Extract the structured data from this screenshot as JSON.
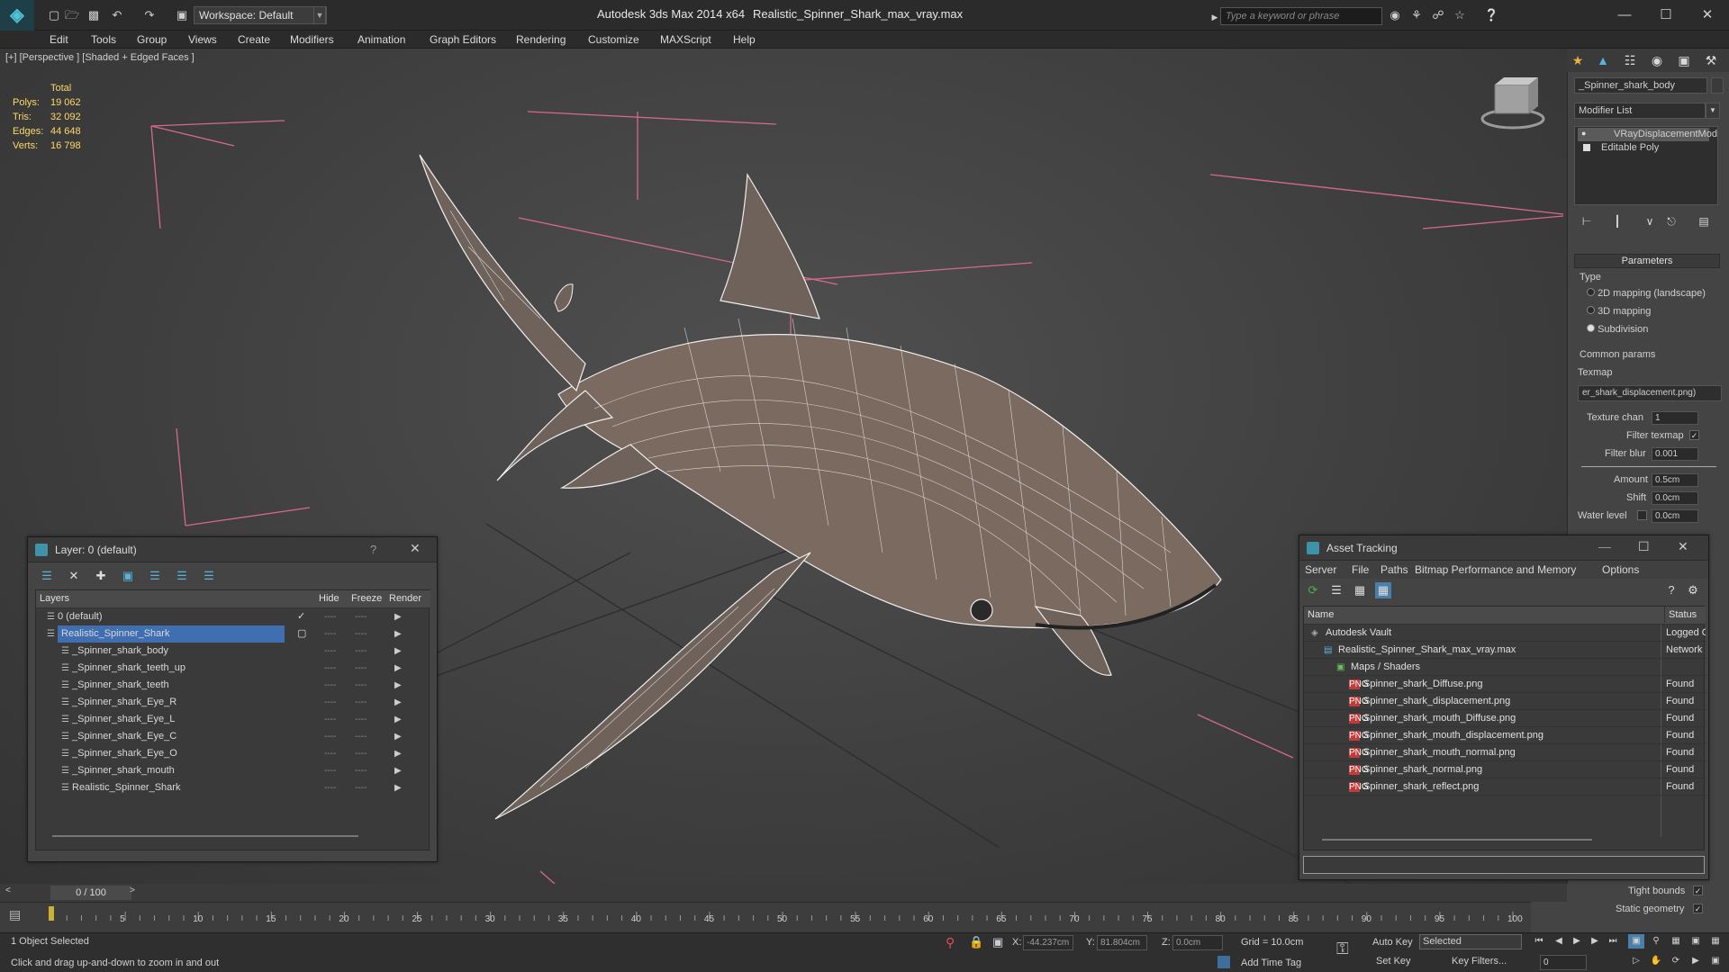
{
  "app": {
    "title": "Autodesk 3ds Max  2014 x64",
    "filename": "Realistic_Spinner_Shark_max_vray.max",
    "workspace": "Workspace: Default",
    "search_placeholder": "Type a keyword or phrase"
  },
  "menu": [
    "Edit",
    "Tools",
    "Group",
    "Views",
    "Create",
    "Modifiers",
    "Animation",
    "Graph Editors",
    "Rendering",
    "Customize",
    "MAXScript",
    "Help"
  ],
  "viewport": {
    "label": "[+] [Perspective ] [Shaded + Edged Faces ]",
    "stats": {
      "header": "Total",
      "rows": [
        {
          "label": "Polys:",
          "value": "19 062"
        },
        {
          "label": "Tris:",
          "value": "32 092"
        },
        {
          "label": "Edges:",
          "value": "44 648"
        },
        {
          "label": "Verts:",
          "value": "16 798"
        }
      ]
    }
  },
  "command_panel": {
    "object_name": "_Spinner_shark_body",
    "modifier_list": "Modifier List",
    "stack": [
      "VRayDisplacementMod",
      "Editable Poly"
    ],
    "parameters_title": "Parameters",
    "type_label": "Type",
    "type_options": [
      "2D mapping (landscape)",
      "3D mapping",
      "Subdivision"
    ],
    "selected_type": 2,
    "common_params": "Common params",
    "texmap_label": "Texmap",
    "texmap_value": "er_shark_displacement.png)",
    "texture_chan_label": "Texture chan",
    "texture_chan_value": "1",
    "filter_texmap_label": "Filter texmap",
    "filter_blur_label": "Filter blur",
    "filter_blur_value": "0.001",
    "amount_label": "Amount",
    "amount_value": "0.5cm",
    "shift_label": "Shift",
    "shift_value": "0.0cm",
    "water_level_label": "Water level",
    "water_level_value": "0.0cm",
    "tight_bounds": "Tight bounds",
    "static_geometry": "Static geometry"
  },
  "layer_dialog": {
    "title": "Layer: 0 (default)",
    "help": "?",
    "columns": [
      "Layers",
      "Hide",
      "Freeze",
      "Render"
    ],
    "rows": [
      {
        "name": "0 (default)",
        "indent": 1,
        "selected": false
      },
      {
        "name": "Realistic_Spinner_Shark",
        "indent": 1,
        "selected": true
      },
      {
        "name": "_Spinner_shark_body",
        "indent": 2,
        "selected": false
      },
      {
        "name": "_Spinner_shark_teeth_up",
        "indent": 2,
        "selected": false
      },
      {
        "name": "_Spinner_shark_teeth",
        "indent": 2,
        "selected": false
      },
      {
        "name": "_Spinner_shark_Eye_R",
        "indent": 2,
        "selected": false
      },
      {
        "name": "_Spinner_shark_Eye_L",
        "indent": 2,
        "selected": false
      },
      {
        "name": "_Spinner_shark_Eye_C",
        "indent": 2,
        "selected": false
      },
      {
        "name": "_Spinner_shark_Eye_O",
        "indent": 2,
        "selected": false
      },
      {
        "name": "_Spinner_shark_mouth",
        "indent": 2,
        "selected": false
      },
      {
        "name": "Realistic_Spinner_Shark",
        "indent": 2,
        "selected": false
      }
    ],
    "dash": "----"
  },
  "asset_dialog": {
    "title": "Asset Tracking",
    "menu": [
      "Server",
      "File",
      "Paths",
      "Bitmap Performance and Memory",
      "Options"
    ],
    "columns": [
      "Name",
      "Status"
    ],
    "rows": [
      {
        "name": "Autodesk Vault",
        "status": "Logged O",
        "level": 1,
        "icon": "vault"
      },
      {
        "name": "Realistic_Spinner_Shark_max_vray.max",
        "status": "Network",
        "level": 2,
        "icon": "file"
      },
      {
        "name": "Maps / Shaders",
        "status": "",
        "level": 3,
        "icon": "folder"
      },
      {
        "name": "Spinner_shark_Diffuse.png",
        "status": "Found",
        "level": 4,
        "icon": "png"
      },
      {
        "name": "Spinner_shark_displacement.png",
        "status": "Found",
        "level": 4,
        "icon": "png"
      },
      {
        "name": "Spinner_shark_mouth_Diffuse.png",
        "status": "Found",
        "level": 4,
        "icon": "png"
      },
      {
        "name": "Spinner_shark_mouth_displacement.png",
        "status": "Found",
        "level": 4,
        "icon": "png"
      },
      {
        "name": "Spinner_shark_mouth_normal.png",
        "status": "Found",
        "level": 4,
        "icon": "png"
      },
      {
        "name": "Spinner_shark_normal.png",
        "status": "Found",
        "level": 4,
        "icon": "png"
      },
      {
        "name": "Spinner_shark_reflect.png",
        "status": "Found",
        "level": 4,
        "icon": "png"
      }
    ]
  },
  "timeline": {
    "frame": "0 / 100",
    "ticks": [
      "5",
      "10",
      "15",
      "20",
      "25",
      "30",
      "35",
      "40",
      "45",
      "50",
      "55",
      "60",
      "65",
      "70",
      "75",
      "80",
      "85",
      "90",
      "95",
      "100"
    ]
  },
  "status": {
    "selection": "1 Object Selected",
    "prompt": "Click and drag up-and-down to zoom in and out",
    "x_label": "X:",
    "x_value": "-44.237cm",
    "y_label": "Y:",
    "y_value": "81.804cm",
    "z_label": "Z:",
    "z_value": "0.0cm",
    "grid": "Grid = 10.0cm",
    "add_time_tag": "Add Time Tag",
    "auto_key": "Auto Key",
    "set_key": "Set Key",
    "selected": "Selected",
    "key_filters": "Key Filters...",
    "frame_value": "0"
  }
}
